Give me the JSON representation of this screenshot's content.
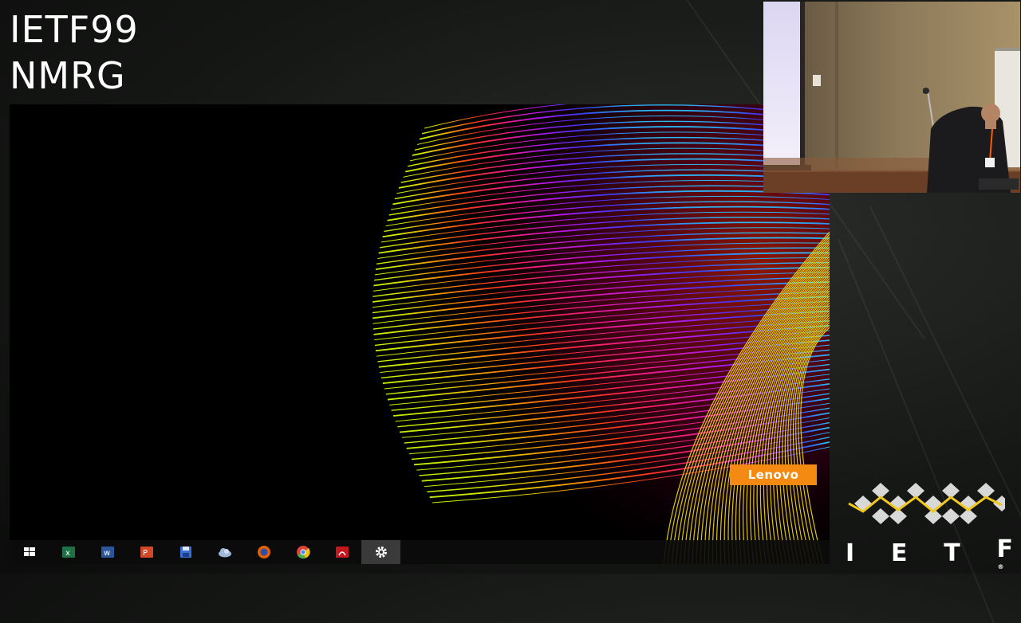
{
  "overlay": {
    "title_line1": "IETF99",
    "title_line2": "NMRG"
  },
  "shared_screen": {
    "brand_badge": "Lenovo",
    "brand_color": "#f58a12",
    "taskbar": [
      {
        "name": "windows-start-icon",
        "color": "#ffffff",
        "active": false
      },
      {
        "name": "excel-icon",
        "color": "#1e7145",
        "active": false
      },
      {
        "name": "word-icon",
        "color": "#2b579a",
        "active": false
      },
      {
        "name": "powerpoint-icon",
        "color": "#d24726",
        "active": false
      },
      {
        "name": "save-disk-icon",
        "color": "#3b6fd6",
        "active": false
      },
      {
        "name": "onedrive-cloud-icon",
        "color": "#9fb7d9",
        "active": false
      },
      {
        "name": "firefox-icon",
        "color": "#e66000",
        "active": false
      },
      {
        "name": "chrome-icon",
        "color": "#4caf50",
        "active": false
      },
      {
        "name": "acrobat-icon",
        "color": "#c4161c",
        "active": false
      },
      {
        "name": "settings-gear-icon",
        "color": "#ffffff",
        "active": true
      }
    ]
  },
  "logo": {
    "letters": [
      "I",
      "E",
      "T",
      "F"
    ],
    "registered_mark": "®",
    "accent_color": "#f2c81e"
  }
}
